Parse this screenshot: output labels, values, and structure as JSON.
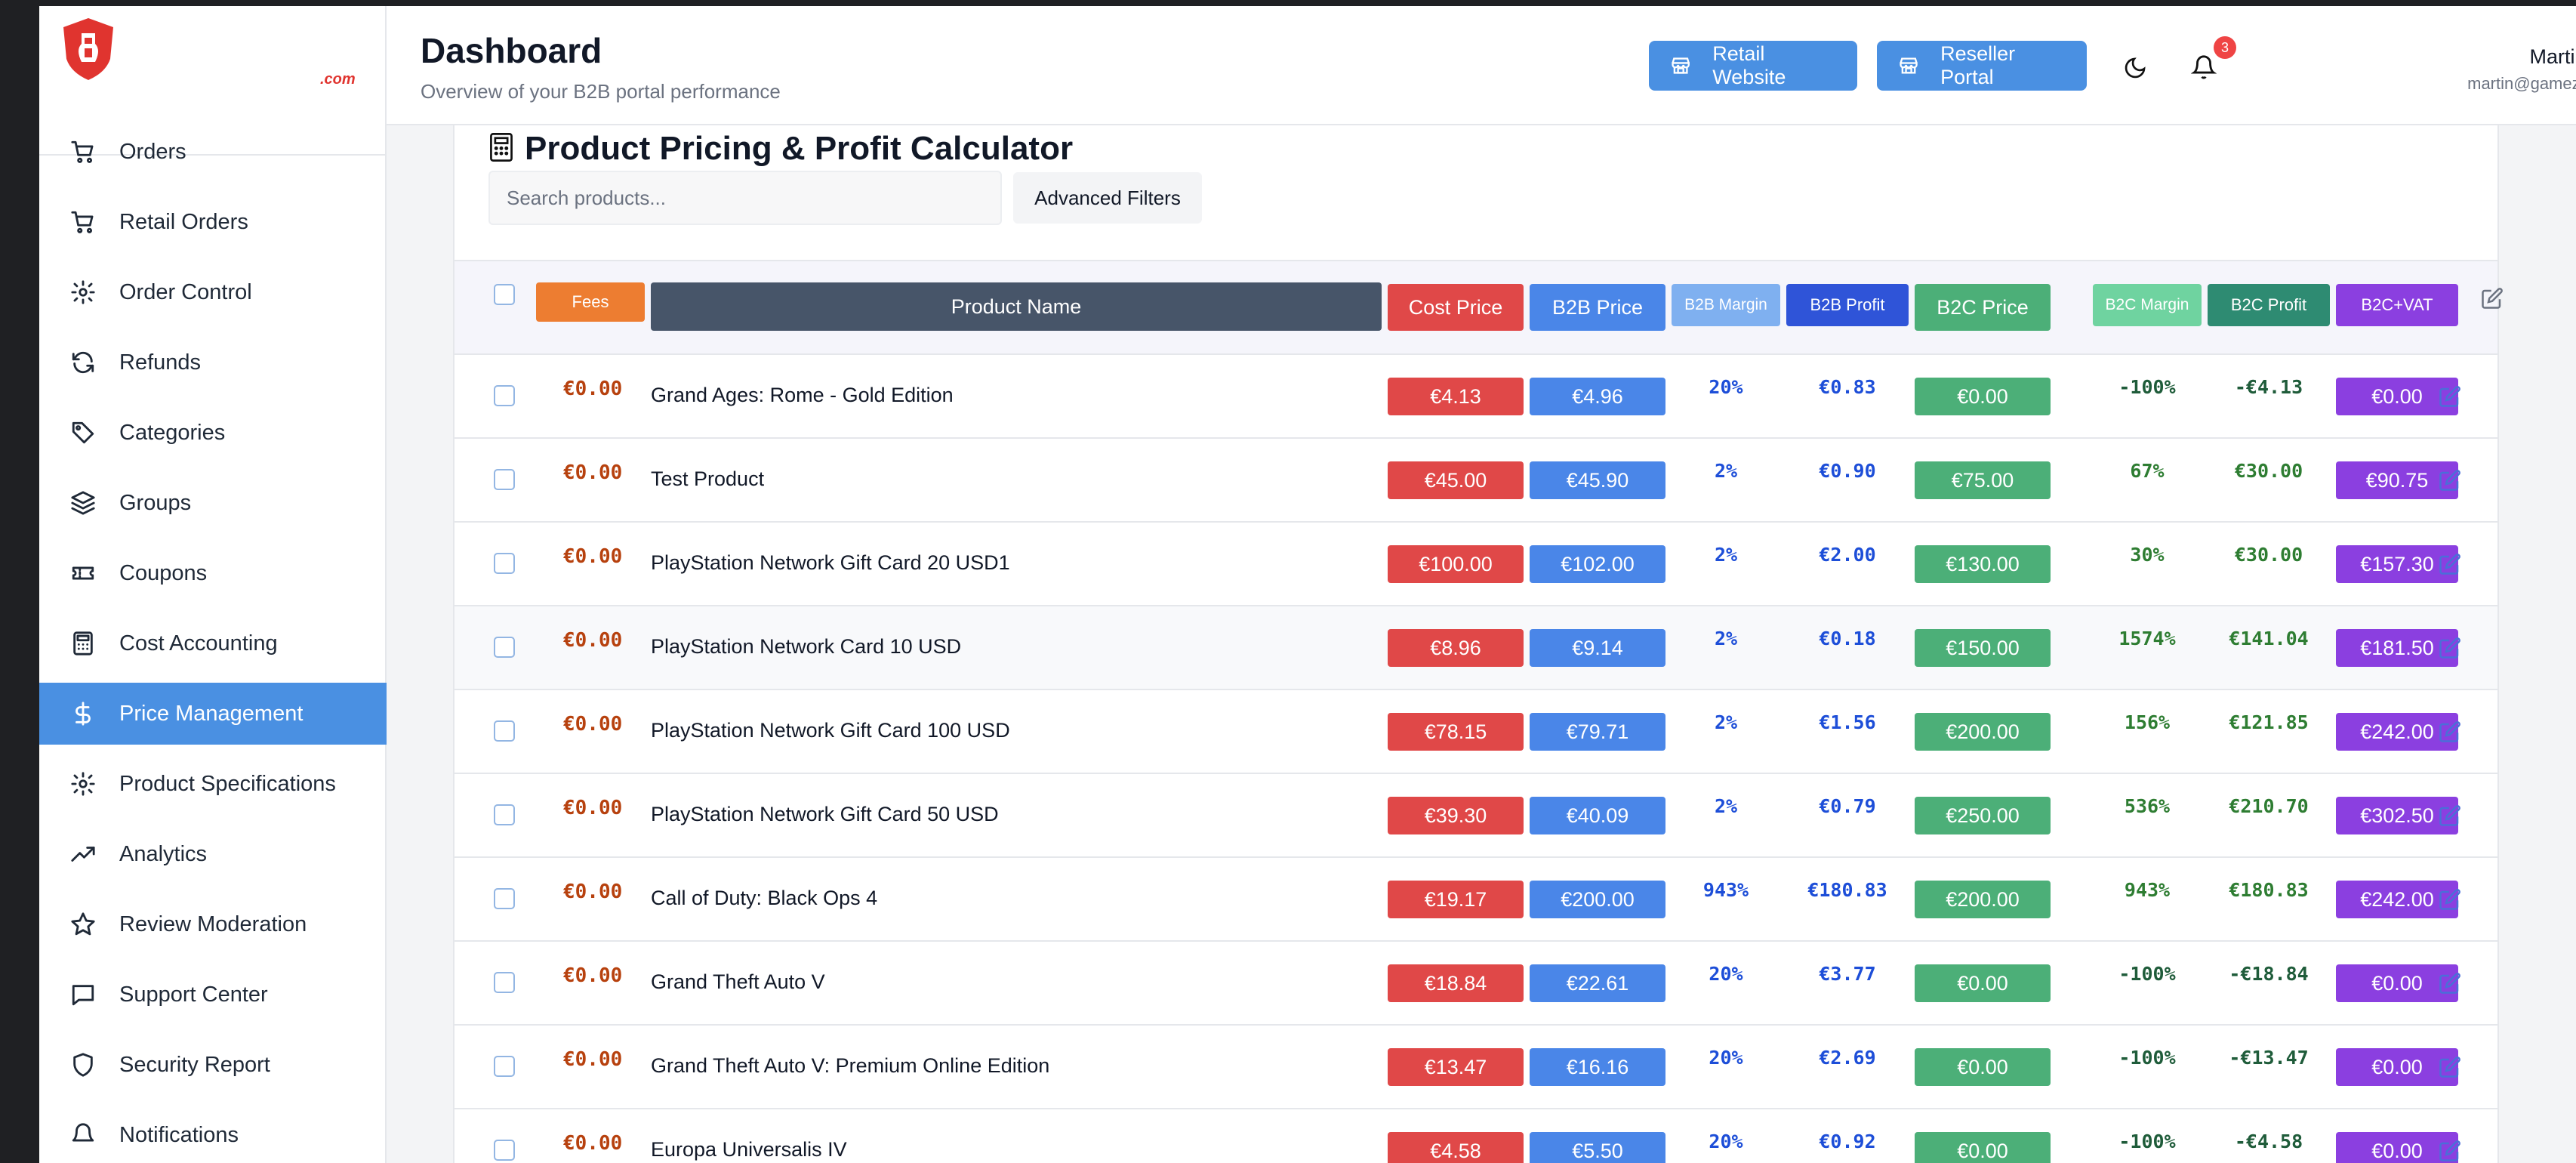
{
  "brand": {
    "domain_suffix": ".com"
  },
  "header": {
    "title": "Dashboard",
    "subtitle": "Overview of your B2B portal performance",
    "retail_button": "Retail Website",
    "reseller_button": "Reseller Portal",
    "notification_count": "3",
    "user_name": "Martin Smith",
    "user_email": "martin@gamezone.com"
  },
  "sidebar": {
    "items": [
      {
        "label": "Orders",
        "icon": "cart-icon"
      },
      {
        "label": "Retail Orders",
        "icon": "cart-icon"
      },
      {
        "label": "Order Control",
        "icon": "gear-icon"
      },
      {
        "label": "Refunds",
        "icon": "refresh-icon"
      },
      {
        "label": "Categories",
        "icon": "tags-icon"
      },
      {
        "label": "Groups",
        "icon": "layers-icon"
      },
      {
        "label": "Coupons",
        "icon": "ticket-icon"
      },
      {
        "label": "Cost Accounting",
        "icon": "calculator-icon"
      },
      {
        "label": "Price Management",
        "icon": "dollar-icon",
        "active": true
      },
      {
        "label": "Product Specifications",
        "icon": "gear-icon"
      },
      {
        "label": "Analytics",
        "icon": "trend-icon"
      },
      {
        "label": "Review Moderation",
        "icon": "star-icon"
      },
      {
        "label": "Support Center",
        "icon": "chat-icon"
      },
      {
        "label": "Security Report",
        "icon": "shield-icon"
      },
      {
        "label": "Notifications",
        "icon": "bell-icon"
      }
    ]
  },
  "calculator": {
    "title": "Product Pricing & Profit Calculator",
    "search_placeholder": "Search products...",
    "filters_button": "Advanced Filters"
  },
  "table": {
    "columns": {
      "fees": "Fees",
      "name": "Product Name",
      "cost": "Cost Price",
      "b2b_price": "B2B Price",
      "b2b_margin": "B2B Margin",
      "b2b_profit": "B2B Profit",
      "b2c_price": "B2C Price",
      "b2c_margin": "B2C Margin",
      "b2c_profit": "B2C Profit",
      "b2c_vat": "B2C+VAT"
    },
    "rows": [
      {
        "fees": "€0.00",
        "name": "Grand Ages: Rome - Gold Edition",
        "cost": "€4.13",
        "b2b_price": "€4.96",
        "b2b_margin": "20%",
        "b2b_profit": "€0.83",
        "b2c_price": "€0.00",
        "b2c_margin": "-100%",
        "b2c_profit": "-€4.13",
        "b2c_vat": "€0.00"
      },
      {
        "fees": "€0.00",
        "name": "Test Product",
        "cost": "€45.00",
        "b2b_price": "€45.90",
        "b2b_margin": "2%",
        "b2b_profit": "€0.90",
        "b2c_price": "€75.00",
        "b2c_margin": "67%",
        "b2c_profit": "€30.00",
        "b2c_vat": "€90.75"
      },
      {
        "fees": "€0.00",
        "name": "PlayStation Network Gift Card 20 USD1",
        "cost": "€100.00",
        "b2b_price": "€102.00",
        "b2b_margin": "2%",
        "b2b_profit": "€2.00",
        "b2c_price": "€130.00",
        "b2c_margin": "30%",
        "b2c_profit": "€30.00",
        "b2c_vat": "€157.30"
      },
      {
        "fees": "€0.00",
        "name": "PlayStation Network Card 10 USD",
        "cost": "€8.96",
        "b2b_price": "€9.14",
        "b2b_margin": "2%",
        "b2b_profit": "€0.18",
        "b2c_price": "€150.00",
        "b2c_margin": "1574%",
        "b2c_profit": "€141.04",
        "b2c_vat": "€181.50"
      },
      {
        "fees": "€0.00",
        "name": "PlayStation Network Gift Card 100 USD",
        "cost": "€78.15",
        "b2b_price": "€79.71",
        "b2b_margin": "2%",
        "b2b_profit": "€1.56",
        "b2c_price": "€200.00",
        "b2c_margin": "156%",
        "b2c_profit": "€121.85",
        "b2c_vat": "€242.00"
      },
      {
        "fees": "€0.00",
        "name": "PlayStation Network Gift Card 50 USD",
        "cost": "€39.30",
        "b2b_price": "€40.09",
        "b2b_margin": "2%",
        "b2b_profit": "€0.79",
        "b2c_price": "€250.00",
        "b2c_margin": "536%",
        "b2c_profit": "€210.70",
        "b2c_vat": "€302.50"
      },
      {
        "fees": "€0.00",
        "name": "Call of Duty: Black Ops 4",
        "cost": "€19.17",
        "b2b_price": "€200.00",
        "b2b_margin": "943%",
        "b2b_profit": "€180.83",
        "b2c_price": "€200.00",
        "b2c_margin": "943%",
        "b2c_profit": "€180.83",
        "b2c_vat": "€242.00"
      },
      {
        "fees": "€0.00",
        "name": "Grand Theft Auto V",
        "cost": "€18.84",
        "b2b_price": "€22.61",
        "b2b_margin": "20%",
        "b2b_profit": "€3.77",
        "b2c_price": "€0.00",
        "b2c_margin": "-100%",
        "b2c_profit": "-€18.84",
        "b2c_vat": "€0.00"
      },
      {
        "fees": "€0.00",
        "name": "Grand Theft Auto V: Premium Online Edition",
        "cost": "€13.47",
        "b2b_price": "€16.16",
        "b2b_margin": "20%",
        "b2b_profit": "€2.69",
        "b2c_price": "€0.00",
        "b2c_margin": "-100%",
        "b2c_profit": "-€13.47",
        "b2c_vat": "€0.00"
      },
      {
        "fees": "€0.00",
        "name": "Europa Universalis IV",
        "cost": "€4.58",
        "b2b_price": "€5.50",
        "b2b_margin": "20%",
        "b2b_profit": "€0.92",
        "b2c_price": "€0.00",
        "b2c_margin": "-100%",
        "b2c_profit": "-€4.58",
        "b2c_vat": "€0.00"
      }
    ]
  },
  "colors": {
    "accent": "#4a90e2",
    "fees": "#ed7d31",
    "name_header": "#475569",
    "cost": "#e04848",
    "b2b_price": "#4a86e8",
    "b2b_margin_header": "#7fb0f0",
    "b2b_profit_header": "#2f54d8",
    "b2c_price": "#4caf78",
    "b2c_margin_header": "#6fd3a0",
    "b2c_profit_header": "#2e8b72",
    "b2c_vat": "#8b3fe0",
    "logo_red": "#e0342f"
  }
}
